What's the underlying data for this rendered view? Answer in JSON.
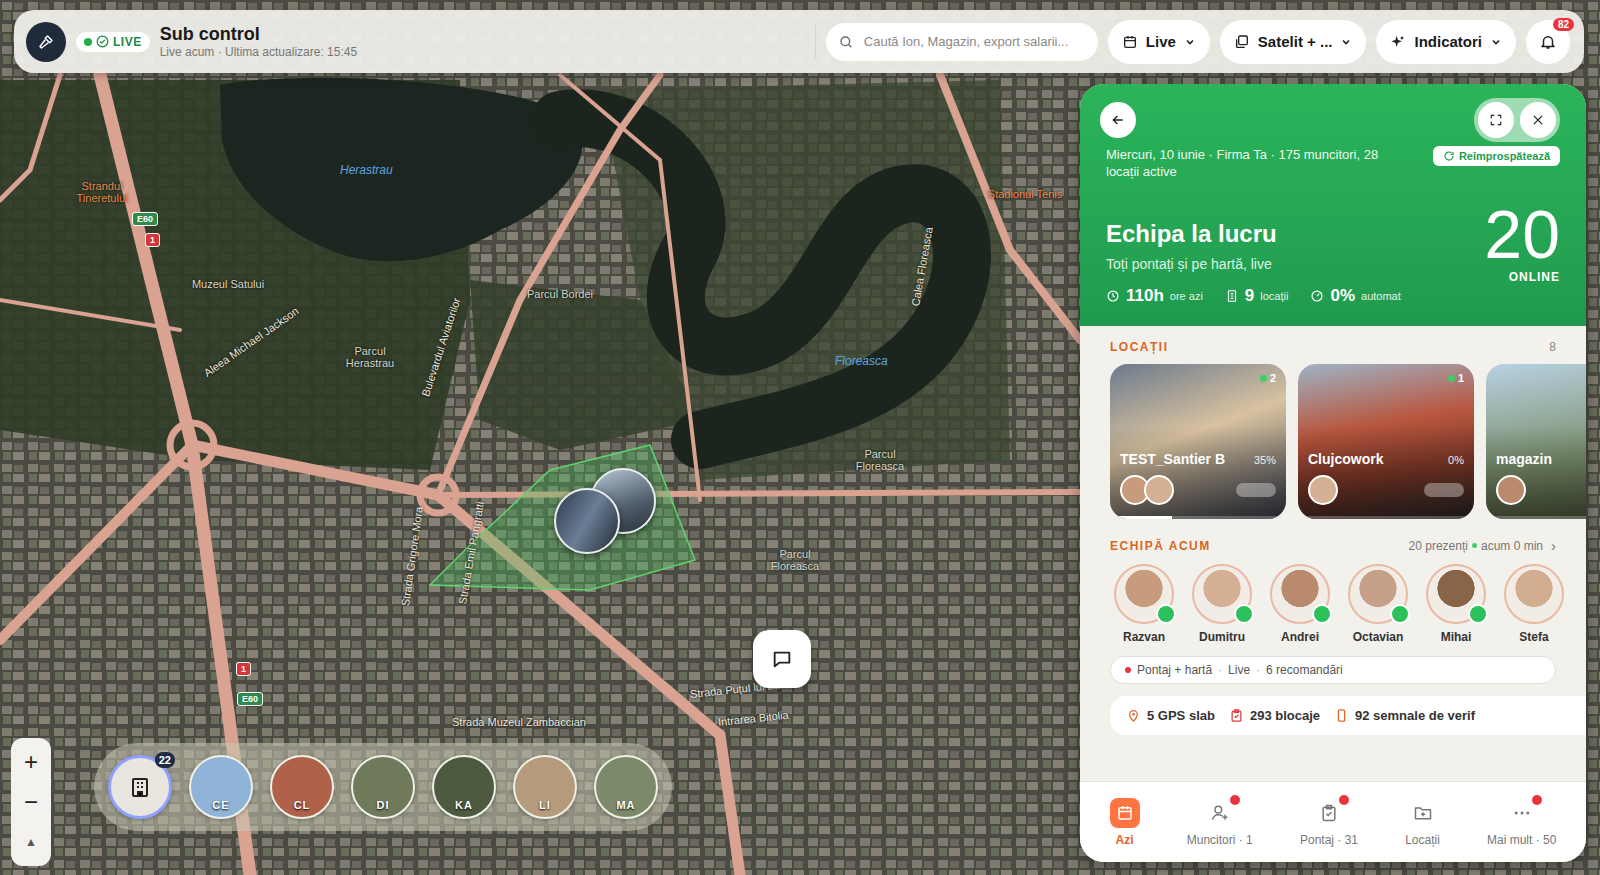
{
  "top_bar": {
    "live_badge": "LIVE",
    "title": "Sub control",
    "subtitle": "Live acum · Ultima actualizare: 15:45",
    "search_placeholder": "Caută Ion, Magazin, export salarii...",
    "dropdowns": [
      {
        "label": "Live",
        "icon": "calendar"
      },
      {
        "label": "Satelit + ...",
        "icon": "layers"
      },
      {
        "label": "Indicatori",
        "icon": "sparkle"
      }
    ],
    "notifications": "82"
  },
  "map": {
    "labels": [
      {
        "text": "Herastrau",
        "kind": "water"
      },
      {
        "text": "Floreasca",
        "kind": "water"
      },
      {
        "text": "Strandul Tineretului",
        "kind": "poi"
      },
      {
        "text": "Stadionul Tenis",
        "kind": "poi"
      },
      {
        "text": "Muzeul Satului",
        "kind": "park"
      },
      {
        "text": "Parcul Herastrau",
        "kind": "park"
      },
      {
        "text": "Parcul Bordei",
        "kind": "park"
      },
      {
        "text": "Parcul Floreasca",
        "kind": "park"
      },
      {
        "text": "Parcul Floreasca",
        "kind": "park"
      },
      {
        "text": "Aleea Michael Jackson",
        "kind": "street"
      },
      {
        "text": "Bulevardul Aviatorilor",
        "kind": "street"
      },
      {
        "text": "Strada Muzeul Zambaccian",
        "kind": "street"
      },
      {
        "text": "Strada Puțul lui Zamfir",
        "kind": "street"
      },
      {
        "text": "Intrarea Bitolia",
        "kind": "street"
      },
      {
        "text": "Calea Floreasca",
        "kind": "street"
      },
      {
        "text": "Strada Grigore Mora",
        "kind": "street"
      },
      {
        "text": "Strada Emil Pangratti",
        "kind": "street"
      }
    ],
    "shields": [
      {
        "text": "E60",
        "kind": "euro"
      },
      {
        "text": "1",
        "kind": "national"
      },
      {
        "text": "1",
        "kind": "national"
      },
      {
        "text": "E60",
        "kind": "euro"
      }
    ],
    "zoom_in": "+",
    "zoom_out": "−",
    "compass": "▲"
  },
  "location_strip": [
    {
      "kind": "all",
      "label": "",
      "count": "22",
      "selected": true
    },
    {
      "kind": "location",
      "label": "CE",
      "count": "",
      "selected": false
    },
    {
      "kind": "location",
      "label": "CL",
      "count": "",
      "selected": false
    },
    {
      "kind": "location",
      "label": "DI",
      "count": "",
      "selected": false
    },
    {
      "kind": "location",
      "label": "KA",
      "count": "",
      "selected": false
    },
    {
      "kind": "location",
      "label": "LI",
      "count": "",
      "selected": false
    },
    {
      "kind": "location",
      "label": "MA",
      "count": "",
      "selected": false
    }
  ],
  "panel": {
    "date_line": "Miercuri, 10 iunie · Firma Ta · 175 muncitori, 28 locații active",
    "refresh": "Reîmprospătează",
    "title": "Echipa la lucru",
    "subtitle": "Toți pontați și pe hartă, live",
    "online_count": "20",
    "online_label": "ONLINE",
    "stats": [
      {
        "value": "110h",
        "label": "ore azi",
        "icon": "clock"
      },
      {
        "value": "9",
        "label": "locații",
        "icon": "building"
      },
      {
        "value": "0%",
        "label": "automat",
        "icon": "gauge"
      }
    ],
    "locations_title": "LOCAȚII",
    "locations_count": "8",
    "locations": [
      {
        "name": "TEST_Santier B",
        "percent": "35%",
        "count": "2",
        "avatars": 2,
        "level": 0.35
      },
      {
        "name": "Clujcowork",
        "percent": "0%",
        "count": "1",
        "avatars": 1,
        "level": 0
      },
      {
        "name": "magazin",
        "percent": "",
        "count": "",
        "avatars": 1,
        "level": 0
      }
    ],
    "team_title": "ECHIPĂ ACUM",
    "team_count": "20 prezenți",
    "team_time": "acum 0 min",
    "team_chevron": "›",
    "team": [
      {
        "name": "Razvan",
        "online": true
      },
      {
        "name": "Dumitru",
        "online": true
      },
      {
        "name": "Andrei",
        "online": true
      },
      {
        "name": "Octavian",
        "online": true
      },
      {
        "name": "Mihai",
        "online": true
      },
      {
        "name": "Stefa",
        "online": false
      }
    ],
    "status_pill": {
      "items": [
        "Pontaj + hartă",
        "Live",
        "6 recomandări"
      ],
      "separator": "·"
    },
    "chips": [
      {
        "text": "5 GPS slab",
        "icon": "pin"
      },
      {
        "text": "293 blocaje",
        "icon": "clipboard"
      },
      {
        "text": "92 semnale de verif",
        "icon": "phone"
      }
    ],
    "nav": [
      {
        "label": "Azi",
        "icon": "calendar",
        "selected": true,
        "badge": false
      },
      {
        "label": "Muncitori · 1",
        "icon": "user",
        "selected": false,
        "badge": true
      },
      {
        "label": "Pontaj · 31",
        "icon": "clipboard",
        "selected": false,
        "badge": true
      },
      {
        "label": "Locații",
        "icon": "folder",
        "selected": false,
        "badge": false
      },
      {
        "label": "Mai mult · 50",
        "icon": "dots",
        "selected": false,
        "badge": true
      }
    ]
  }
}
